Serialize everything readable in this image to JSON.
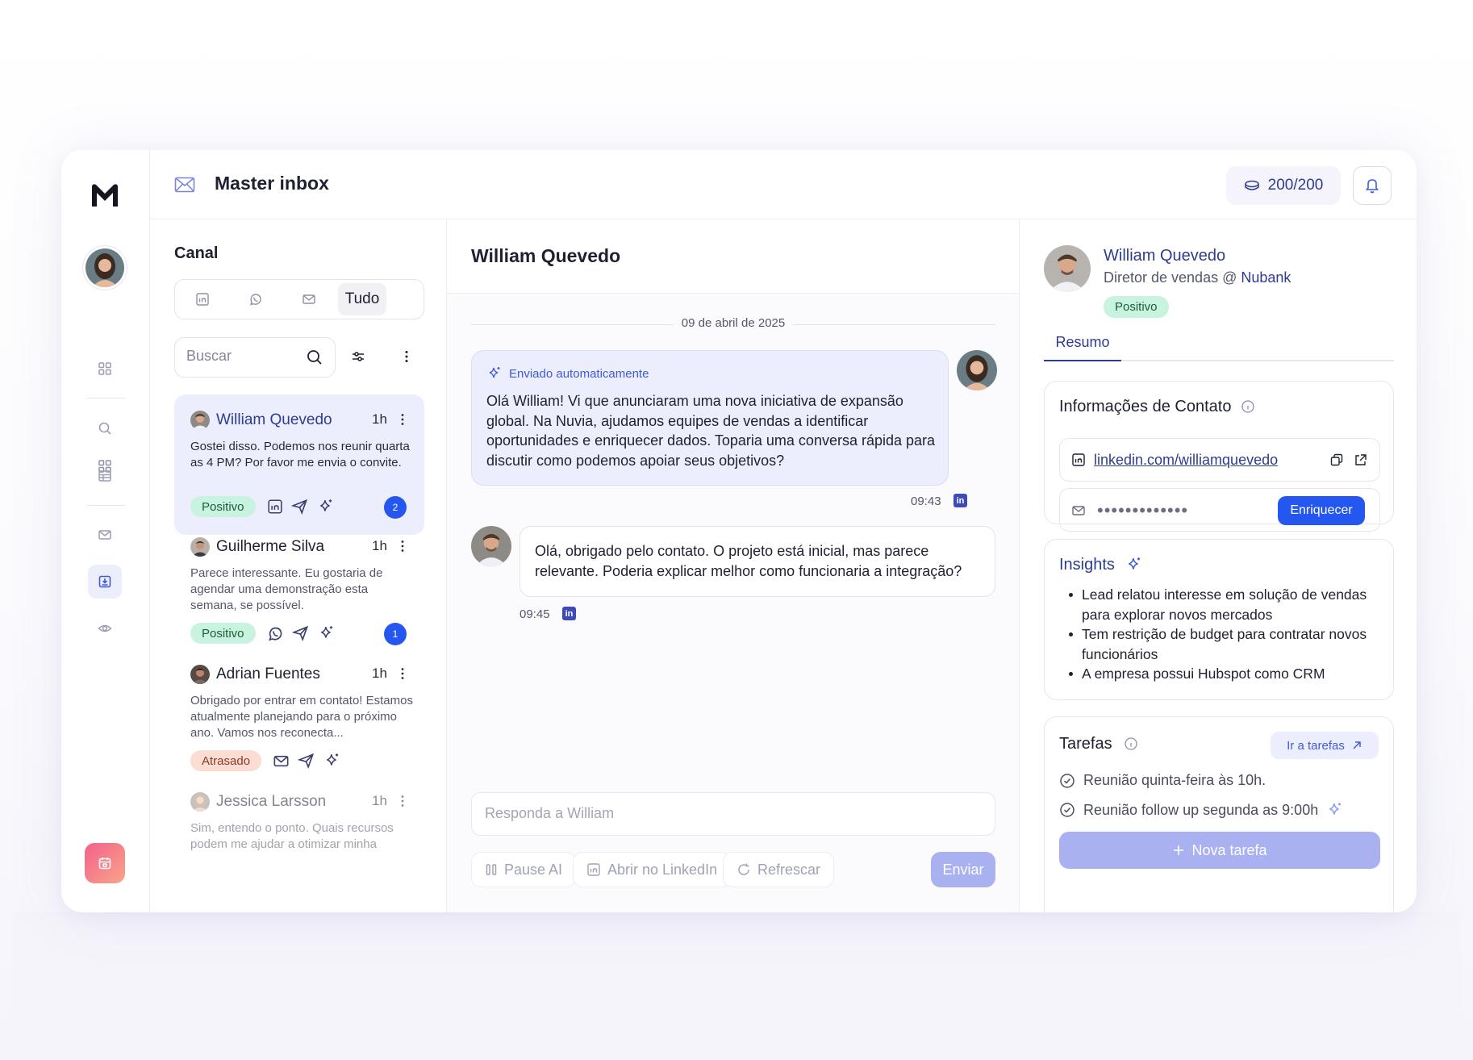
{
  "header": {
    "title": "Master inbox",
    "credits": "200/200"
  },
  "list": {
    "title": "Canal",
    "tabs": [
      "in",
      "whatsapp",
      "email",
      "Tudo"
    ],
    "active_tab": "Tudo",
    "search_placeholder": "Buscar",
    "conversations": [
      {
        "name": "William Quevedo",
        "time": "1h",
        "text": "Gostei disso. Podemos nos reunir quarta as 4 PM? Por favor me envia o convite.",
        "badge": "Positivo",
        "count": "2"
      },
      {
        "name": "Guilherme Silva",
        "time": "1h",
        "text": "Parece interessante. Eu gostaria de agendar uma demonstração esta semana, se possível.",
        "badge": "Positivo",
        "count": "1"
      },
      {
        "name": "Adrian Fuentes",
        "time": "1h",
        "text": "Obrigado por entrar em contato! Estamos atualmente planejando para o próximo ano. Vamos nos reconecta...",
        "badge": "Atrasado"
      },
      {
        "name": "Jessica Larsson",
        "time": "1h",
        "text": "Sim, entendo o ponto. Quais recursos podem me ajudar a otimizar minha"
      }
    ]
  },
  "chat": {
    "title": "William Quevedo",
    "date": "09 de abril de 2025",
    "messages": [
      {
        "label": "Enviado automaticamente",
        "text": "Olá William! Vi que anunciaram uma nova iniciativa de expansão global. Na Nuvia, ajudamos equipes de vendas a identificar oportunidades e enriquecer dados. Toparia uma conversa rápida para discutir como podemos apoiar seus objetivos?",
        "time": "09:43"
      },
      {
        "text": "Olá, obrigado pelo contato. O projeto está inicial, mas parece relevante. Poderia explicar melhor como funcionaria a integração?",
        "time": "09:45"
      }
    ],
    "reply_placeholder": "Responda a William",
    "actions": {
      "pause": "Pause AI",
      "linkedin": "Abrir no LinkedIn",
      "refresh": "Refrescar",
      "send": "Enviar"
    }
  },
  "side": {
    "name": "William Quevedo",
    "role": "Diretor de vendas @",
    "company": "Nubank",
    "badge": "Positivo",
    "tab": "Resumo",
    "contact": {
      "title": "Informações de Contato",
      "linkedin": "linkedin.com/williamquevedo",
      "email_masked": "•••••••••••••",
      "enrich": "Enriquecer"
    },
    "insights": {
      "title": "Insights",
      "items": [
        "Lead relatou interesse em solução de vendas para explorar novos mercados",
        "Tem restrição de budget para contratar novos funcionários",
        "A empresa possui Hubspot como CRM"
      ]
    },
    "tasks": {
      "title": "Tarefas",
      "goto": "Ir a tarefas",
      "items": [
        "Reunião quinta-feira às 10h.",
        "Reunião follow up segunda as 9:00h"
      ],
      "new": "Nova tarefa"
    }
  },
  "colors": {
    "accent": "#2456f0",
    "brand_text": "#2e3c8e",
    "positive": "#c8f3df",
    "late": "#fcdcd3"
  }
}
